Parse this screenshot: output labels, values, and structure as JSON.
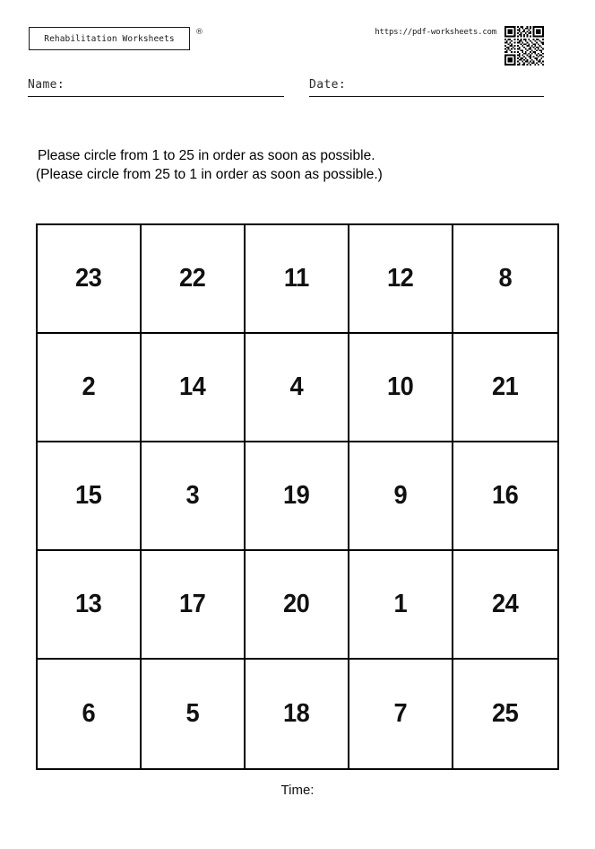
{
  "header": {
    "brand_label": "Rehabilitation Worksheets",
    "registered_mark": "®",
    "site_url": "https://pdf-worksheets.com",
    "qr_icon": "qr-code-icon"
  },
  "fields": {
    "name_label": "Name:",
    "name_value": "",
    "date_label": "Date:",
    "date_value": ""
  },
  "instructions": {
    "line_1": "Please circle from 1 to 25 in order as soon as possible.",
    "line_2": "(Please circle from 25 to 1 in order as soon as possible.)"
  },
  "grid": {
    "rows": 5,
    "columns": 5,
    "numbers": [
      [
        "23",
        "22",
        "11",
        "12",
        "8"
      ],
      [
        "2",
        "14",
        "4",
        "10",
        "21"
      ],
      [
        "15",
        "3",
        "19",
        "9",
        "16"
      ],
      [
        "13",
        "17",
        "20",
        "1",
        "24"
      ],
      [
        "6",
        "5",
        "18",
        "7",
        "25"
      ]
    ]
  },
  "footer": {
    "time_label": "Time:",
    "time_value": ""
  }
}
